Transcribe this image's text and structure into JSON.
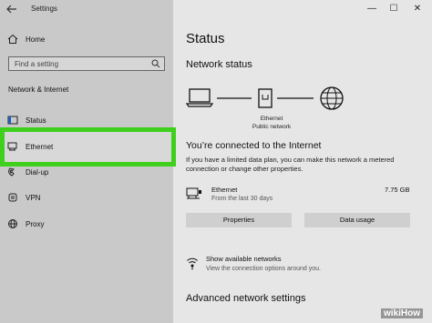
{
  "app": {
    "title": "Settings"
  },
  "window_controls": {
    "minimize": "—",
    "maximize": "☐",
    "close": "✕"
  },
  "sidebar": {
    "home_label": "Home",
    "search_placeholder": "Find a setting",
    "section_title": "Network & Internet",
    "items": [
      {
        "label": "Status",
        "icon": "status-icon"
      },
      {
        "label": "Ethernet",
        "icon": "ethernet-icon",
        "selected": true
      },
      {
        "label": "Dial-up",
        "icon": "dialup-icon"
      },
      {
        "label": "VPN",
        "icon": "vpn-icon"
      },
      {
        "label": "Proxy",
        "icon": "proxy-icon"
      }
    ]
  },
  "main": {
    "title": "Status",
    "network_status_heading": "Network status",
    "diagram": {
      "label_line1": "Ethernet",
      "label_line2": "Public network"
    },
    "connected_text": "You’re connected to the Internet",
    "description": "If you have a limited data plan, you can make this network a metered connection or change other properties.",
    "ethernet": {
      "name": "Ethernet",
      "subtitle": "From the last 30 days",
      "usage": "7.75 GB"
    },
    "properties_button": "Properties",
    "data_usage_button": "Data usage",
    "show_networks": {
      "title": "Show available networks",
      "subtitle": "View the connection options around you."
    },
    "advanced_heading": "Advanced network settings"
  },
  "watermark": "wikiHow",
  "colors": {
    "highlight": "#3ed01c",
    "sidebar_bg": "#c9c9c9",
    "main_bg": "#e6e6e6"
  }
}
